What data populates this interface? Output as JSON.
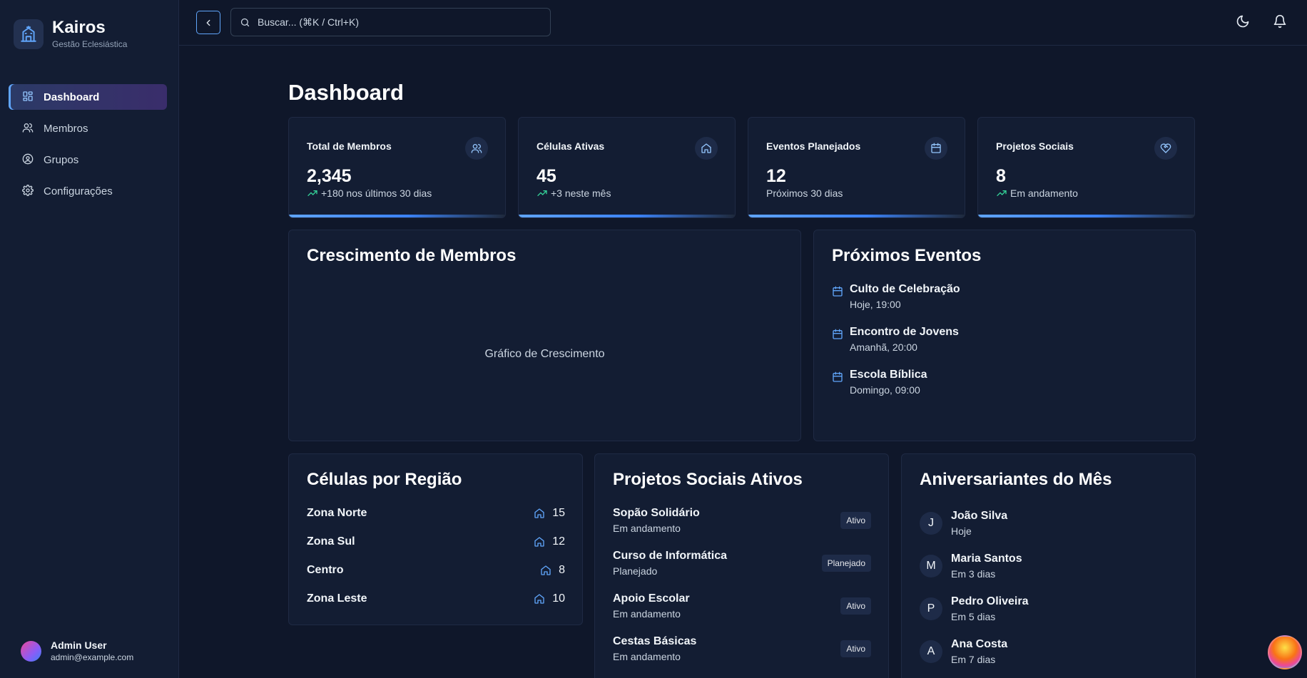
{
  "brand": {
    "title": "Kairos",
    "subtitle": "Gestão Eclesiástica"
  },
  "nav": [
    {
      "label": "Dashboard",
      "icon": "dashboard-icon",
      "active": true
    },
    {
      "label": "Membros",
      "icon": "users-icon"
    },
    {
      "label": "Grupos",
      "icon": "user-circle-icon"
    },
    {
      "label": "Configurações",
      "icon": "gear-icon"
    }
  ],
  "user": {
    "name": "Admin User",
    "email": "admin@example.com"
  },
  "search": {
    "placeholder": "Buscar... (⌘K / Ctrl+K)"
  },
  "page": {
    "title": "Dashboard"
  },
  "stats": [
    {
      "label": "Total de Membros",
      "value": "2,345",
      "sub": "+180 nos últimos 30 dias",
      "icon": "users-icon",
      "trend": true
    },
    {
      "label": "Células Ativas",
      "value": "45",
      "sub": "+3 neste mês",
      "icon": "home-icon",
      "trend": true
    },
    {
      "label": "Eventos Planejados",
      "value": "12",
      "sub": "Próximos 30 dias",
      "icon": "calendar-icon",
      "trend": false
    },
    {
      "label": "Projetos Sociais",
      "value": "8",
      "sub": "Em andamento",
      "icon": "heart-handshake-icon",
      "trend": true
    }
  ],
  "growth": {
    "title": "Crescimento de Membros",
    "placeholder": "Gráfico de Crescimento"
  },
  "events": {
    "title": "Próximos Eventos",
    "items": [
      {
        "name": "Culto de Celebração",
        "when": "Hoje, 19:00"
      },
      {
        "name": "Encontro de Jovens",
        "when": "Amanhã, 20:00"
      },
      {
        "name": "Escola Bíblica",
        "when": "Domingo, 09:00"
      }
    ]
  },
  "regions": {
    "title": "Células por Região",
    "items": [
      {
        "name": "Zona Norte",
        "count": "15"
      },
      {
        "name": "Zona Sul",
        "count": "12"
      },
      {
        "name": "Centro",
        "count": "8"
      },
      {
        "name": "Zona Leste",
        "count": "10"
      }
    ]
  },
  "projects": {
    "title": "Projetos Sociais Ativos",
    "items": [
      {
        "name": "Sopão Solidário",
        "sub": "Em andamento",
        "badge": "Ativo"
      },
      {
        "name": "Curso de Informática",
        "sub": "Planejado",
        "badge": "Planejado"
      },
      {
        "name": "Apoio Escolar",
        "sub": "Em andamento",
        "badge": "Ativo"
      },
      {
        "name": "Cestas Básicas",
        "sub": "Em andamento",
        "badge": "Ativo"
      }
    ]
  },
  "birthdays": {
    "title": "Aniversariantes do Mês",
    "items": [
      {
        "initial": "J",
        "name": "João Silva",
        "when": "Hoje"
      },
      {
        "initial": "M",
        "name": "Maria Santos",
        "when": "Em 3 dias"
      },
      {
        "initial": "P",
        "name": "Pedro Oliveira",
        "when": "Em 5 dias"
      },
      {
        "initial": "A",
        "name": "Ana Costa",
        "when": "Em 7 dias"
      }
    ]
  },
  "colors": {
    "accent": "#60a5fa",
    "background": "#0f172a",
    "card": "#131d33"
  }
}
